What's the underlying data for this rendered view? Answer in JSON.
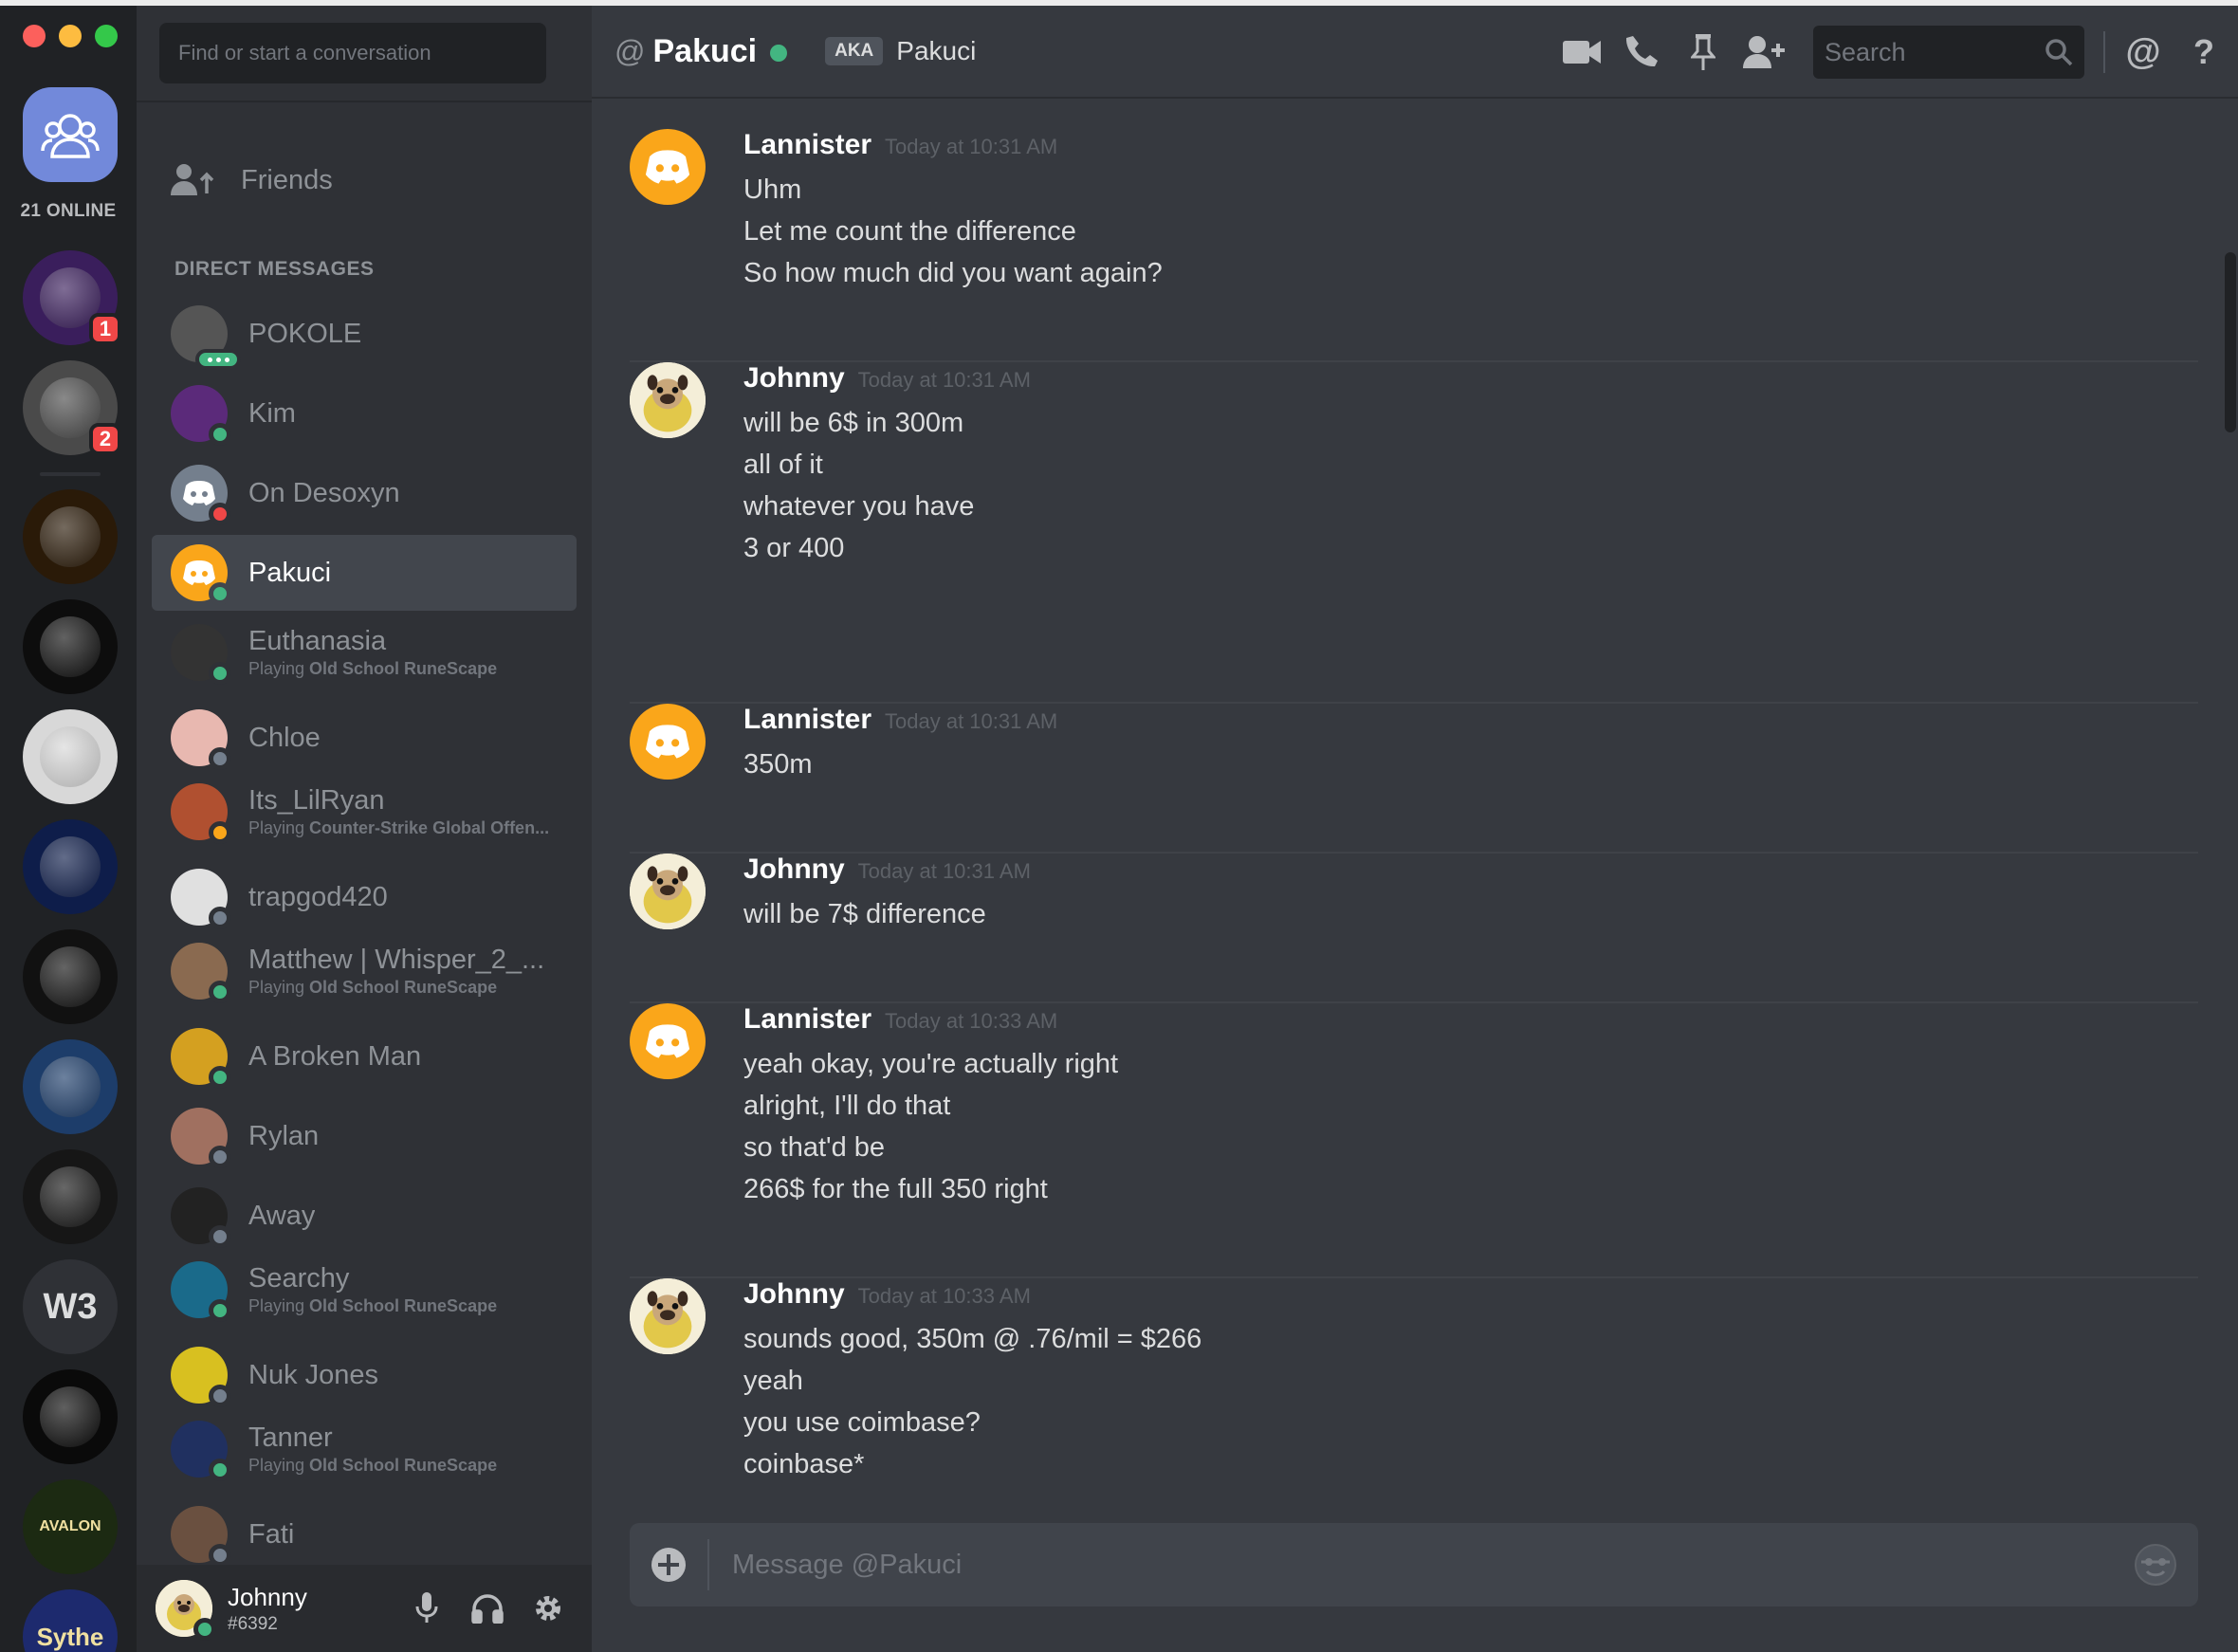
{
  "guilds": {
    "online_label": "21 ONLINE",
    "items": [
      {
        "name": "owl-server",
        "badge": "1",
        "color": "#3a1e5c"
      },
      {
        "name": "portrait-server",
        "badge": "2",
        "color": "#4a4a4a"
      },
      {
        "name": "golden-helmet-server",
        "badge": "",
        "color": "#2a1a08"
      },
      {
        "name": "dkss-server",
        "badge": "",
        "color": "#0d0d0d"
      },
      {
        "name": "bearded-man-server",
        "badge": "",
        "color": "#d8d8d8"
      },
      {
        "name": "un-emblem-server",
        "badge": "",
        "color": "#0e1d4a"
      },
      {
        "name": "beast-server",
        "badge": "",
        "color": "#111111"
      },
      {
        "name": "skull-server",
        "badge": "",
        "color": "#1d3d6a"
      },
      {
        "name": "soldier-server",
        "badge": "",
        "color": "#161616"
      },
      {
        "name": "w3-server",
        "badge": "",
        "text": "W3",
        "color": "#2f3136"
      },
      {
        "name": "venom-server",
        "badge": "",
        "color": "#0a0a0a"
      },
      {
        "name": "avalon-server",
        "badge": "",
        "text": "AVALON",
        "color": "#1c2a12"
      },
      {
        "name": "sythe-server",
        "badge": "",
        "text": "Sythe",
        "color": "#1d2a6e"
      }
    ]
  },
  "dm_sidebar": {
    "search_placeholder": "Find or start a conversation",
    "friends_label": "Friends",
    "section_header": "DIRECT MESSAGES",
    "items": [
      {
        "name": "POKOLE",
        "activity": "",
        "game": "",
        "status": "typing",
        "color": "#555"
      },
      {
        "name": "Kim",
        "activity": "",
        "game": "",
        "status": "online",
        "color": "#5b2a7a"
      },
      {
        "name": "On Desoxyn",
        "activity": "",
        "game": "",
        "status": "dnd",
        "color": "#747f8d"
      },
      {
        "name": "Pakuci",
        "activity": "",
        "game": "",
        "status": "online",
        "color": "#faa61a",
        "active": true
      },
      {
        "name": "Euthanasia",
        "activity": "Playing ",
        "game": "Old School RuneScape",
        "status": "online",
        "color": "#333"
      },
      {
        "name": "Chloe",
        "activity": "",
        "game": "",
        "status": "offline",
        "color": "#e8b8b0"
      },
      {
        "name": "Its_LilRyan",
        "activity": "Playing ",
        "game": "Counter-Strike Global Offen...",
        "status": "idle",
        "color": "#b05030"
      },
      {
        "name": "trapgod420",
        "activity": "",
        "game": "",
        "status": "offline",
        "color": "#e0e0e0"
      },
      {
        "name": "Matthew | Whisper_2_...",
        "activity": "Playing ",
        "game": "Old School RuneScape",
        "status": "online",
        "color": "#8a6a50"
      },
      {
        "name": "A Broken Man",
        "activity": "",
        "game": "",
        "status": "online",
        "color": "#d4a020"
      },
      {
        "name": "Rylan",
        "activity": "",
        "game": "",
        "status": "offline",
        "color": "#a07060"
      },
      {
        "name": "Away",
        "activity": "",
        "game": "",
        "status": "offline",
        "color": "#222"
      },
      {
        "name": "Searchy",
        "activity": "Playing ",
        "game": "Old School RuneScape",
        "status": "online",
        "color": "#1a6a8a"
      },
      {
        "name": "Nuk Jones",
        "activity": "",
        "game": "",
        "status": "offline",
        "color": "#d8c020"
      },
      {
        "name": "Tanner",
        "activity": "Playing ",
        "game": "Old School RuneScape",
        "status": "online",
        "color": "#203060"
      },
      {
        "name": "Fati",
        "activity": "",
        "game": "",
        "status": "offline",
        "color": "#6a5040"
      }
    ]
  },
  "user_panel": {
    "username": "Johnny",
    "tag": "#6392"
  },
  "chat_header": {
    "at_symbol": "@",
    "channel_name": "Pakuci",
    "aka_label": "AKA",
    "nickname": "Pakuci",
    "search_placeholder": "Search",
    "mention_symbol": "@",
    "help_symbol": "?"
  },
  "messages": [
    {
      "author": "Lannister",
      "timestamp": "Today at 10:31 AM",
      "avatar": "discord-orange",
      "lines": [
        "Uhm",
        "Let me count the difference",
        "So how much did you want again?"
      ]
    },
    {
      "author": "Johnny",
      "timestamp": "Today at 10:31 AM",
      "avatar": "pug",
      "lines": [
        "will be 6$ in 300m",
        "all of it",
        "whatever you have",
        "3 or 400"
      ]
    },
    {
      "author": "Lannister",
      "timestamp": "Today at 10:31 AM",
      "avatar": "discord-orange",
      "lines": [
        "350m"
      ]
    },
    {
      "author": "Johnny",
      "timestamp": "Today at 10:31 AM",
      "avatar": "pug",
      "lines": [
        "will be 7$ difference"
      ]
    },
    {
      "author": "Lannister",
      "timestamp": "Today at 10:33 AM",
      "avatar": "discord-orange",
      "lines": [
        "yeah okay, you're actually right",
        "alright, I'll do that",
        "so that'd be",
        "266$ for the full 350 right"
      ]
    },
    {
      "author": "Johnny",
      "timestamp": "Today at 10:33 AM",
      "avatar": "pug",
      "lines": [
        "sounds good, 350m @ .76/mil = $266",
        "yeah",
        "you use coimbase?",
        "coinbase*"
      ]
    }
  ],
  "composer": {
    "placeholder": "Message @Pakuci"
  },
  "colors": {
    "blurple": "#7289da",
    "online": "#43b581",
    "dnd": "#f04747",
    "idle": "#faa61a",
    "offline": "#747f8d",
    "discord_orange": "#faa61a"
  }
}
